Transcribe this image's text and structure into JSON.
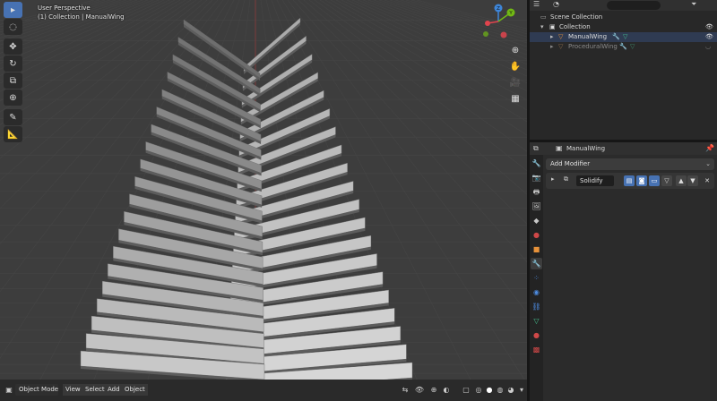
{
  "viewport": {
    "perspective_label": "User Perspective",
    "context_label": "(1) Collection | ManualWing",
    "gizmo": {
      "x_color": "#e2444d",
      "y_color": "#71b814",
      "z_color": "#3e86d9",
      "z_label": "Z",
      "y_label": "Y"
    },
    "toolbar": [
      {
        "name": "select-box-tool",
        "glyph": "▸"
      },
      {
        "name": "cursor-tool",
        "glyph": "◌"
      },
      {
        "name": "move-tool",
        "glyph": "✥"
      },
      {
        "name": "rotate-tool",
        "glyph": "↻"
      },
      {
        "name": "scale-tool",
        "glyph": "⧉"
      },
      {
        "name": "transform-tool",
        "glyph": "⊕"
      },
      {
        "name": "annotate-tool",
        "glyph": "✎"
      },
      {
        "name": "measure-tool",
        "glyph": "📐"
      }
    ],
    "nav_buttons": [
      {
        "name": "zoom-icon",
        "glyph": "⊕"
      },
      {
        "name": "hand-icon",
        "glyph": "✋"
      },
      {
        "name": "camera-icon",
        "glyph": "🎥"
      },
      {
        "name": "grid-icon",
        "glyph": "▦"
      }
    ],
    "header": {
      "mode": "Object Mode",
      "menus": [
        "View",
        "Select",
        "Add",
        "Object"
      ]
    }
  },
  "outliner": {
    "scene_collection": "Scene Collection",
    "collection": "Collection",
    "objects": [
      {
        "name": "ManualWing",
        "dim": false
      },
      {
        "name": "ProceduralWing",
        "dim": true
      }
    ]
  },
  "properties": {
    "object_name": "ManualWing",
    "add_modifier": "Add Modifier",
    "modifier_name": "Solidify",
    "tabs": [
      {
        "name": "tool-tab-icon",
        "glyph": "🔧",
        "color": "#c8c8c8"
      },
      {
        "name": "render-tab-icon",
        "glyph": "📷",
        "color": "#c8c8c8"
      },
      {
        "name": "output-tab-icon",
        "glyph": "🖶",
        "color": "#c8c8c8"
      },
      {
        "name": "view-layer-tab-icon",
        "glyph": "🖼",
        "color": "#c8c8c8"
      },
      {
        "name": "scene-tab-icon",
        "glyph": "◆",
        "color": "#c8c8c8"
      },
      {
        "name": "world-tab-icon",
        "glyph": "●",
        "color": "#d04848"
      },
      {
        "name": "object-tab-icon",
        "glyph": "■",
        "color": "#e8923a"
      },
      {
        "name": "modifier-tab-icon",
        "glyph": "🔧",
        "color": "#4d8be0"
      },
      {
        "name": "particles-tab-icon",
        "glyph": "⁘",
        "color": "#4d8be0"
      },
      {
        "name": "physics-tab-icon",
        "glyph": "◉",
        "color": "#4d8be0"
      },
      {
        "name": "constraints-tab-icon",
        "glyph": "⛓",
        "color": "#4d8be0"
      },
      {
        "name": "data-tab-icon",
        "glyph": "▽",
        "color": "#45c08e"
      },
      {
        "name": "material-tab-icon",
        "glyph": "●",
        "color": "#d04848"
      },
      {
        "name": "texture-tab-icon",
        "glyph": "▩",
        "color": "#d04848"
      }
    ]
  }
}
